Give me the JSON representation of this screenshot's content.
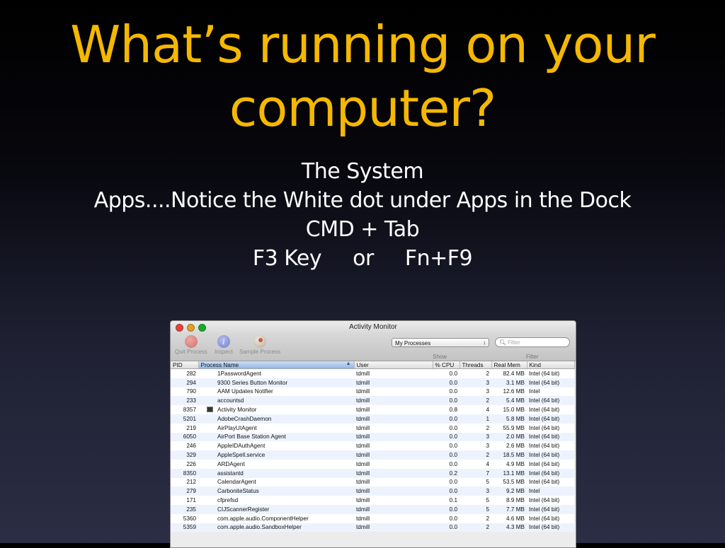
{
  "slide": {
    "title": "What’s running on your computer?",
    "lines": [
      "The System",
      "Apps....Notice the White dot under Apps in the Dock",
      "CMD + Tab"
    ],
    "keys": [
      "F3 Key",
      "or",
      "Fn+F9"
    ]
  },
  "window": {
    "title": "Activity Monitor",
    "toolbar": {
      "quit_label": "Quit Process",
      "inspect_label": "Inspect",
      "sample_label": "Sample Process",
      "show_select": "My Processes",
      "show_label": "Show",
      "filter_placeholder": "Filter",
      "filter_label": "Filter"
    },
    "columns": [
      "PID",
      "Process Name",
      "User",
      "% CPU",
      "Threads",
      "Real Mem",
      "Kind"
    ],
    "rows": [
      {
        "pid": "282",
        "name": "1PasswordAgent",
        "user": "tdmill",
        "cpu": "0.0",
        "threads": "2",
        "mem": "82.4 MB",
        "kind": "Intel (64 bit)"
      },
      {
        "pid": "294",
        "name": "9300 Series Button Monitor",
        "user": "tdmill",
        "cpu": "0.0",
        "threads": "3",
        "mem": "3.1 MB",
        "kind": "Intel (64 bit)"
      },
      {
        "pid": "790",
        "name": "AAM Updates Notifier",
        "user": "tdmill",
        "cpu": "0.0",
        "threads": "3",
        "mem": "12.6 MB",
        "kind": "Intel"
      },
      {
        "pid": "233",
        "name": "accountsd",
        "user": "tdmill",
        "cpu": "0.0",
        "threads": "2",
        "mem": "5.4 MB",
        "kind": "Intel (64 bit)"
      },
      {
        "pid": "8357",
        "name": "Activity Monitor",
        "user": "tdmill",
        "cpu": "0.8",
        "threads": "4",
        "mem": "15.0 MB",
        "kind": "Intel (64 bit)",
        "icon": "activity-monitor-icon"
      },
      {
        "pid": "5201",
        "name": "AdobeCrashDaemon",
        "user": "tdmill",
        "cpu": "0.0",
        "threads": "1",
        "mem": "5.8 MB",
        "kind": "Intel (64 bit)"
      },
      {
        "pid": "219",
        "name": "AirPlayUIAgent",
        "user": "tdmill",
        "cpu": "0.0",
        "threads": "2",
        "mem": "55.9 MB",
        "kind": "Intel (64 bit)"
      },
      {
        "pid": "6050",
        "name": "AirPort Base Station Agent",
        "user": "tdmill",
        "cpu": "0.0",
        "threads": "3",
        "mem": "2.0 MB",
        "kind": "Intel (64 bit)"
      },
      {
        "pid": "246",
        "name": "AppleIDAuthAgent",
        "user": "tdmill",
        "cpu": "0.0",
        "threads": "3",
        "mem": "2.6 MB",
        "kind": "Intel (64 bit)"
      },
      {
        "pid": "329",
        "name": "AppleSpell.service",
        "user": "tdmill",
        "cpu": "0.0",
        "threads": "2",
        "mem": "18.5 MB",
        "kind": "Intel (64 bit)"
      },
      {
        "pid": "226",
        "name": "ARDAgent",
        "user": "tdmill",
        "cpu": "0.0",
        "threads": "4",
        "mem": "4.9 MB",
        "kind": "Intel (64 bit)"
      },
      {
        "pid": "8350",
        "name": "assistantd",
        "user": "tdmill",
        "cpu": "0.2",
        "threads": "7",
        "mem": "13.1 MB",
        "kind": "Intel (64 bit)"
      },
      {
        "pid": "212",
        "name": "CalendarAgent",
        "user": "tdmill",
        "cpu": "0.0",
        "threads": "5",
        "mem": "53.5 MB",
        "kind": "Intel (64 bit)"
      },
      {
        "pid": "279",
        "name": "CarboniteStatus",
        "user": "tdmill",
        "cpu": "0.0",
        "threads": "3",
        "mem": "9.2 MB",
        "kind": "Intel"
      },
      {
        "pid": "171",
        "name": "cfprefsd",
        "user": "tdmill",
        "cpu": "0.1",
        "threads": "5",
        "mem": "8.9 MB",
        "kind": "Intel (64 bit)"
      },
      {
        "pid": "235",
        "name": "CIJScannerRegister",
        "user": "tdmill",
        "cpu": "0.0",
        "threads": "5",
        "mem": "7.7 MB",
        "kind": "Intel (64 bit)"
      },
      {
        "pid": "5360",
        "name": "com.apple.audio.ComponentHelper",
        "user": "tdmill",
        "cpu": "0.0",
        "threads": "2",
        "mem": "4.6 MB",
        "kind": "Intel (64 bit)"
      },
      {
        "pid": "5359",
        "name": "com.apple.audio.SandboxHelper",
        "user": "tdmill",
        "cpu": "0.0",
        "threads": "2",
        "mem": "4.3 MB",
        "kind": "Intel (64 bit)"
      }
    ]
  }
}
